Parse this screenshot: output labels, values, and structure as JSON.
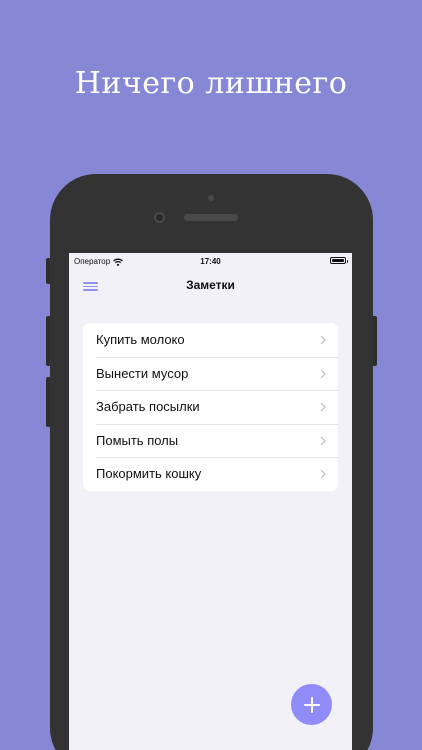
{
  "headline": "Ничего лишнего",
  "status_bar": {
    "carrier": "Оператор",
    "time": "17:40"
  },
  "nav": {
    "title": "Заметки",
    "menu_icon": "hamburger-icon"
  },
  "notes": [
    {
      "label": "Купить молоко"
    },
    {
      "label": "Вынести мусор"
    },
    {
      "label": "Забрать посылки"
    },
    {
      "label": "Помыть полы"
    },
    {
      "label": "Покормить кошку"
    }
  ],
  "fab": {
    "icon": "plus-icon"
  },
  "colors": {
    "background": "#8688d6",
    "accent": "#8f8bf7",
    "phone_body": "#333333",
    "screen_bg": "#f2f1f7"
  }
}
